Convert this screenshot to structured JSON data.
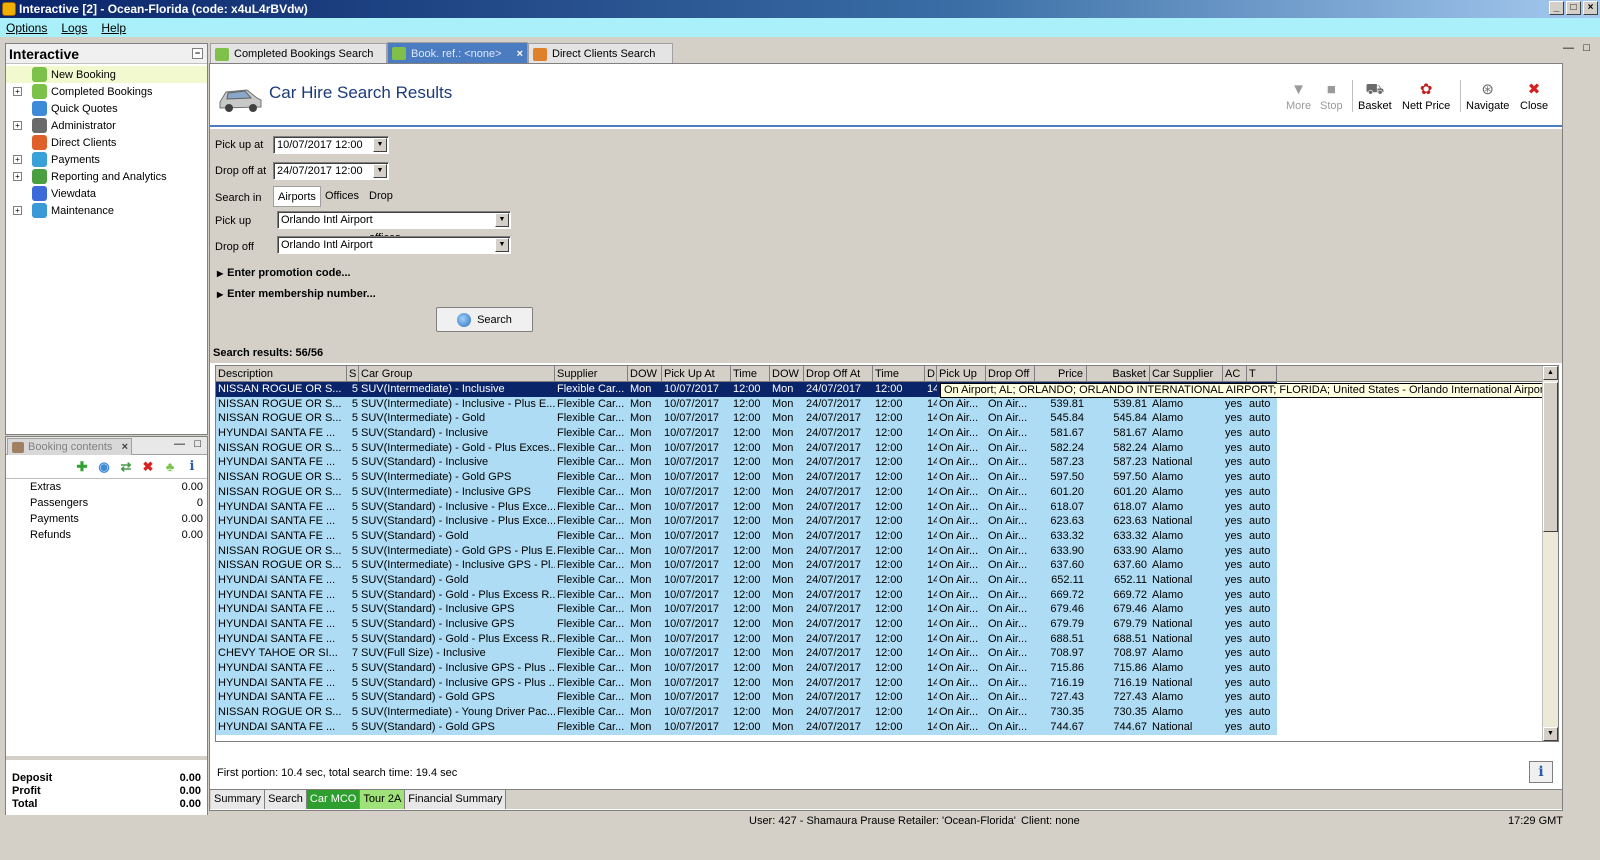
{
  "window": {
    "title": "Interactive [2] - Ocean-Florida (code: x4uL4rBVdw)"
  },
  "menu": [
    "Options",
    "Logs",
    "Help"
  ],
  "nav": {
    "title": "Interactive",
    "items": [
      {
        "label": "New Booking",
        "expand": false,
        "color": "#7cc24a"
      },
      {
        "label": "Completed Bookings",
        "expand": true,
        "color": "#7cc24a"
      },
      {
        "label": "Quick Quotes",
        "expand": false,
        "color": "#3c8ad8"
      },
      {
        "label": "Administrator",
        "expand": true,
        "color": "#6a6a6a"
      },
      {
        "label": "Direct Clients",
        "expand": false,
        "color": "#e0602a"
      },
      {
        "label": "Payments",
        "expand": true,
        "color": "#3aa0d8"
      },
      {
        "label": "Reporting and Analytics",
        "expand": true,
        "color": "#4aa040"
      },
      {
        "label": "Viewdata",
        "expand": false,
        "color": "#3c6ad8"
      },
      {
        "label": "Maintenance",
        "expand": true,
        "color": "#3a9ad8"
      }
    ]
  },
  "booking": {
    "tab_label": "Booking contents",
    "rows": [
      {
        "label": "Extras",
        "value": "0.00"
      },
      {
        "label": "Passengers",
        "value": "0"
      },
      {
        "label": "Payments",
        "value": "0.00"
      },
      {
        "label": "Refunds",
        "value": "0.00"
      }
    ],
    "totals": [
      {
        "label": "Deposit",
        "value": "0.00"
      },
      {
        "label": "Profit",
        "value": "0.00"
      },
      {
        "label": "Total",
        "value": "0.00"
      }
    ]
  },
  "tabs": [
    {
      "label": "Completed Bookings Search"
    },
    {
      "label": "Book. ref.: <none>"
    },
    {
      "label": "Direct Clients Search"
    }
  ],
  "page": {
    "title": "Car Hire Search Results",
    "toolbar": [
      {
        "label": "More",
        "icon": "▼",
        "disabled": true
      },
      {
        "label": "Stop",
        "icon": "■",
        "disabled": true
      },
      {
        "label": "Basket",
        "icon": "⛟",
        "disabled": false
      },
      {
        "label": "Nett Price",
        "icon": "✿",
        "disabled": false
      },
      {
        "label": "Navigate",
        "icon": "⊛",
        "disabled": false
      },
      {
        "label": "Close",
        "icon": "✖",
        "disabled": false
      }
    ]
  },
  "form": {
    "pickup_at_label": "Pick up at",
    "pickup_at_value": "10/07/2017 12:00",
    "dropoff_at_label": "Drop off at",
    "dropoff_at_value": "24/07/2017 12:00",
    "search_in_label": "Search in",
    "search_in_options": [
      "Airports",
      "Offices",
      "Drop off offices"
    ],
    "pickup_label": "Pick up",
    "pickup_value": "Orlando Intl Airport",
    "dropoff_label": "Drop off",
    "dropoff_value": "Orlando Intl Airport",
    "promo_label": "Enter promotion code...",
    "membership_label": "Enter membership number...",
    "search_button": "Search"
  },
  "results": {
    "count_label": "Search results: 56/56",
    "columns": [
      "Description",
      "S",
      "Car Group",
      "Supplier",
      "DOW",
      "Pick Up At",
      "Time",
      "DOW",
      "Drop Off At",
      "Time",
      "D",
      "Pick Up",
      "Drop Off",
      "Price",
      "Basket",
      "Car Supplier",
      "AC",
      "T"
    ],
    "tooltip": "On Airport; AL; ORLANDO; ORLANDO INTERNATIONAL AIRPORT; FLORIDA; United States - Orlando International Airport",
    "rows": [
      [
        "NISSAN ROGUE OR S...",
        "5",
        "SUV(Intermediate) - Inclusive",
        "Flexible Car...",
        "Mon",
        "10/07/2017",
        "12:00",
        "Mon",
        "24/07/2017",
        "12:00",
        "14",
        "",
        "",
        "",
        "",
        "",
        "",
        ""
      ],
      [
        "NISSAN ROGUE OR S...",
        "5",
        "SUV(Intermediate) - Inclusive - Plus E...",
        "Flexible Car...",
        "Mon",
        "10/07/2017",
        "12:00",
        "Mon",
        "24/07/2017",
        "12:00",
        "14",
        "On Air...",
        "On Air...",
        "539.81",
        "539.81",
        "Alamo",
        "yes",
        "auto"
      ],
      [
        "NISSAN ROGUE OR S...",
        "5",
        "SUV(Intermediate) - Gold",
        "Flexible Car...",
        "Mon",
        "10/07/2017",
        "12:00",
        "Mon",
        "24/07/2017",
        "12:00",
        "14",
        "On Air...",
        "On Air...",
        "545.84",
        "545.84",
        "Alamo",
        "yes",
        "auto"
      ],
      [
        "HYUNDAI SANTA FE ...",
        "5",
        "SUV(Standard) - Inclusive",
        "Flexible Car...",
        "Mon",
        "10/07/2017",
        "12:00",
        "Mon",
        "24/07/2017",
        "12:00",
        "14",
        "On Air...",
        "On Air...",
        "581.67",
        "581.67",
        "Alamo",
        "yes",
        "auto"
      ],
      [
        "NISSAN ROGUE OR S...",
        "5",
        "SUV(Intermediate) - Gold - Plus Exces...",
        "Flexible Car...",
        "Mon",
        "10/07/2017",
        "12:00",
        "Mon",
        "24/07/2017",
        "12:00",
        "14",
        "On Air...",
        "On Air...",
        "582.24",
        "582.24",
        "Alamo",
        "yes",
        "auto"
      ],
      [
        "HYUNDAI SANTA FE ...",
        "5",
        "SUV(Standard) - Inclusive",
        "Flexible Car...",
        "Mon",
        "10/07/2017",
        "12:00",
        "Mon",
        "24/07/2017",
        "12:00",
        "14",
        "On Air...",
        "On Air...",
        "587.23",
        "587.23",
        "National",
        "yes",
        "auto"
      ],
      [
        "NISSAN ROGUE OR S...",
        "5",
        "SUV(Intermediate) - Gold GPS",
        "Flexible Car...",
        "Mon",
        "10/07/2017",
        "12:00",
        "Mon",
        "24/07/2017",
        "12:00",
        "14",
        "On Air...",
        "On Air...",
        "597.50",
        "597.50",
        "Alamo",
        "yes",
        "auto"
      ],
      [
        "NISSAN ROGUE OR S...",
        "5",
        "SUV(Intermediate) - Inclusive GPS",
        "Flexible Car...",
        "Mon",
        "10/07/2017",
        "12:00",
        "Mon",
        "24/07/2017",
        "12:00",
        "14",
        "On Air...",
        "On Air...",
        "601.20",
        "601.20",
        "Alamo",
        "yes",
        "auto"
      ],
      [
        "HYUNDAI SANTA FE ...",
        "5",
        "SUV(Standard) - Inclusive - Plus Exce...",
        "Flexible Car...",
        "Mon",
        "10/07/2017",
        "12:00",
        "Mon",
        "24/07/2017",
        "12:00",
        "14",
        "On Air...",
        "On Air...",
        "618.07",
        "618.07",
        "Alamo",
        "yes",
        "auto"
      ],
      [
        "HYUNDAI SANTA FE ...",
        "5",
        "SUV(Standard) - Inclusive - Plus Exce...",
        "Flexible Car...",
        "Mon",
        "10/07/2017",
        "12:00",
        "Mon",
        "24/07/2017",
        "12:00",
        "14",
        "On Air...",
        "On Air...",
        "623.63",
        "623.63",
        "National",
        "yes",
        "auto"
      ],
      [
        "HYUNDAI SANTA FE ...",
        "5",
        "SUV(Standard) - Gold",
        "Flexible Car...",
        "Mon",
        "10/07/2017",
        "12:00",
        "Mon",
        "24/07/2017",
        "12:00",
        "14",
        "On Air...",
        "On Air...",
        "633.32",
        "633.32",
        "Alamo",
        "yes",
        "auto"
      ],
      [
        "NISSAN ROGUE OR S...",
        "5",
        "SUV(Intermediate) - Gold GPS - Plus E...",
        "Flexible Car...",
        "Mon",
        "10/07/2017",
        "12:00",
        "Mon",
        "24/07/2017",
        "12:00",
        "14",
        "On Air...",
        "On Air...",
        "633.90",
        "633.90",
        "Alamo",
        "yes",
        "auto"
      ],
      [
        "NISSAN ROGUE OR S...",
        "5",
        "SUV(Intermediate) - Inclusive GPS - Pl...",
        "Flexible Car...",
        "Mon",
        "10/07/2017",
        "12:00",
        "Mon",
        "24/07/2017",
        "12:00",
        "14",
        "On Air...",
        "On Air...",
        "637.60",
        "637.60",
        "Alamo",
        "yes",
        "auto"
      ],
      [
        "HYUNDAI SANTA FE ...",
        "5",
        "SUV(Standard) - Gold",
        "Flexible Car...",
        "Mon",
        "10/07/2017",
        "12:00",
        "Mon",
        "24/07/2017",
        "12:00",
        "14",
        "On Air...",
        "On Air...",
        "652.11",
        "652.11",
        "National",
        "yes",
        "auto"
      ],
      [
        "HYUNDAI SANTA FE ...",
        "5",
        "SUV(Standard) - Gold - Plus Excess R...",
        "Flexible Car...",
        "Mon",
        "10/07/2017",
        "12:00",
        "Mon",
        "24/07/2017",
        "12:00",
        "14",
        "On Air...",
        "On Air...",
        "669.72",
        "669.72",
        "Alamo",
        "yes",
        "auto"
      ],
      [
        "HYUNDAI SANTA FE ...",
        "5",
        "SUV(Standard) - Inclusive GPS",
        "Flexible Car...",
        "Mon",
        "10/07/2017",
        "12:00",
        "Mon",
        "24/07/2017",
        "12:00",
        "14",
        "On Air...",
        "On Air...",
        "679.46",
        "679.46",
        "Alamo",
        "yes",
        "auto"
      ],
      [
        "HYUNDAI SANTA FE ...",
        "5",
        "SUV(Standard) - Inclusive GPS",
        "Flexible Car...",
        "Mon",
        "10/07/2017",
        "12:00",
        "Mon",
        "24/07/2017",
        "12:00",
        "14",
        "On Air...",
        "On Air...",
        "679.79",
        "679.79",
        "National",
        "yes",
        "auto"
      ],
      [
        "HYUNDAI SANTA FE ...",
        "5",
        "SUV(Standard) - Gold - Plus Excess R...",
        "Flexible Car...",
        "Mon",
        "10/07/2017",
        "12:00",
        "Mon",
        "24/07/2017",
        "12:00",
        "14",
        "On Air...",
        "On Air...",
        "688.51",
        "688.51",
        "National",
        "yes",
        "auto"
      ],
      [
        "CHEVY TAHOE OR SI...",
        "7",
        "SUV(Full Size) - Inclusive",
        "Flexible Car...",
        "Mon",
        "10/07/2017",
        "12:00",
        "Mon",
        "24/07/2017",
        "12:00",
        "14",
        "On Air...",
        "On Air...",
        "708.97",
        "708.97",
        "Alamo",
        "yes",
        "auto"
      ],
      [
        "HYUNDAI SANTA FE ...",
        "5",
        "SUV(Standard) - Inclusive GPS - Plus ...",
        "Flexible Car...",
        "Mon",
        "10/07/2017",
        "12:00",
        "Mon",
        "24/07/2017",
        "12:00",
        "14",
        "On Air...",
        "On Air...",
        "715.86",
        "715.86",
        "Alamo",
        "yes",
        "auto"
      ],
      [
        "HYUNDAI SANTA FE ...",
        "5",
        "SUV(Standard) - Inclusive GPS - Plus ...",
        "Flexible Car...",
        "Mon",
        "10/07/2017",
        "12:00",
        "Mon",
        "24/07/2017",
        "12:00",
        "14",
        "On Air...",
        "On Air...",
        "716.19",
        "716.19",
        "National",
        "yes",
        "auto"
      ],
      [
        "HYUNDAI SANTA FE ...",
        "5",
        "SUV(Standard) - Gold GPS",
        "Flexible Car...",
        "Mon",
        "10/07/2017",
        "12:00",
        "Mon",
        "24/07/2017",
        "12:00",
        "14",
        "On Air...",
        "On Air...",
        "727.43",
        "727.43",
        "Alamo",
        "yes",
        "auto"
      ],
      [
        "NISSAN ROGUE OR S...",
        "5",
        "SUV(Intermediate) - Young Driver Pac...",
        "Flexible Car...",
        "Mon",
        "10/07/2017",
        "12:00",
        "Mon",
        "24/07/2017",
        "12:00",
        "14",
        "On Air...",
        "On Air...",
        "730.35",
        "730.35",
        "Alamo",
        "yes",
        "auto"
      ],
      [
        "HYUNDAI SANTA FE ...",
        "5",
        "SUV(Standard) - Gold GPS",
        "Flexible Car...",
        "Mon",
        "10/07/2017",
        "12:00",
        "Mon",
        "24/07/2017",
        "12:00",
        "14",
        "On Air...",
        "On Air...",
        "744.67",
        "744.67",
        "National",
        "yes",
        "auto"
      ]
    ]
  },
  "timing": "First portion: 10.4 sec, total search time: 19.4 sec",
  "bottom_tabs": [
    {
      "label": "Summary",
      "style": ""
    },
    {
      "label": "Search",
      "style": ""
    },
    {
      "label": "Car MCO",
      "style": "green"
    },
    {
      "label": "Tour 2A",
      "style": "light"
    },
    {
      "label": "Financial Summary",
      "style": ""
    }
  ],
  "status": {
    "user": "User: 427 - Shamaura Prause",
    "retailer": "Retailer: 'Ocean-Florida'",
    "client": "Client: none",
    "time": "17:29 GMT"
  }
}
